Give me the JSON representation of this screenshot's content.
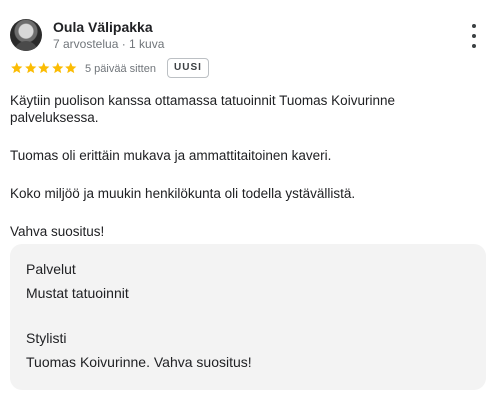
{
  "review": {
    "author_name": "Oula Välipakka",
    "author_meta": "7 arvostelua · 1 kuva",
    "rating": 5,
    "date": "5 päivää sitten",
    "badge": "UUSI",
    "paragraphs": [
      "Käytiin puolison kanssa ottamassa tatuoinnit Tuomas Koivurinne palveluksessa.",
      "Tuomas oli erittäin mukava ja ammattitaitoinen kaveri.",
      "Koko miljöö ja muukin henkilökunta oli todella ystävällistä.",
      "Vahva suositus!"
    ],
    "details": {
      "services_label": "Palvelut",
      "services_value": "Mustat tatuoinnit",
      "stylist_label": "Stylisti",
      "stylist_value": "Tuomas Koivurinne. Vahva suositus!"
    }
  },
  "icons": {
    "more": "more-vert-icon",
    "star": "star-icon"
  },
  "colors": {
    "star": "#fbbc04",
    "meta_text": "#70757a",
    "details_bg": "#f3f3f3"
  }
}
